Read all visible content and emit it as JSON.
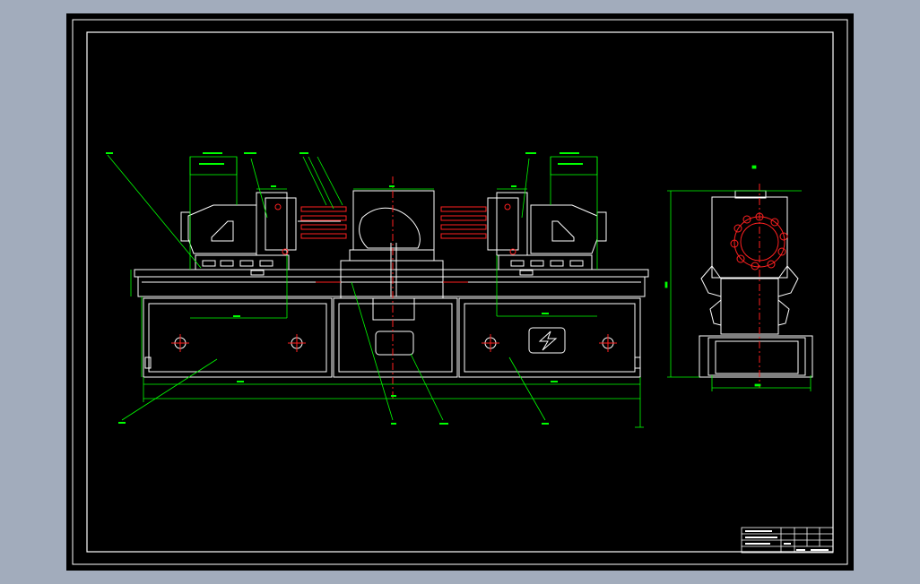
{
  "colors": {
    "viewer_background": "#a2acbc",
    "sheet_background": "#000000",
    "frame_lines": "#ffffff",
    "dimension_lines": "#00ff00",
    "center_lines": "#ff2020"
  },
  "title_block": {
    "rows": [
      "",
      ""
    ]
  }
}
